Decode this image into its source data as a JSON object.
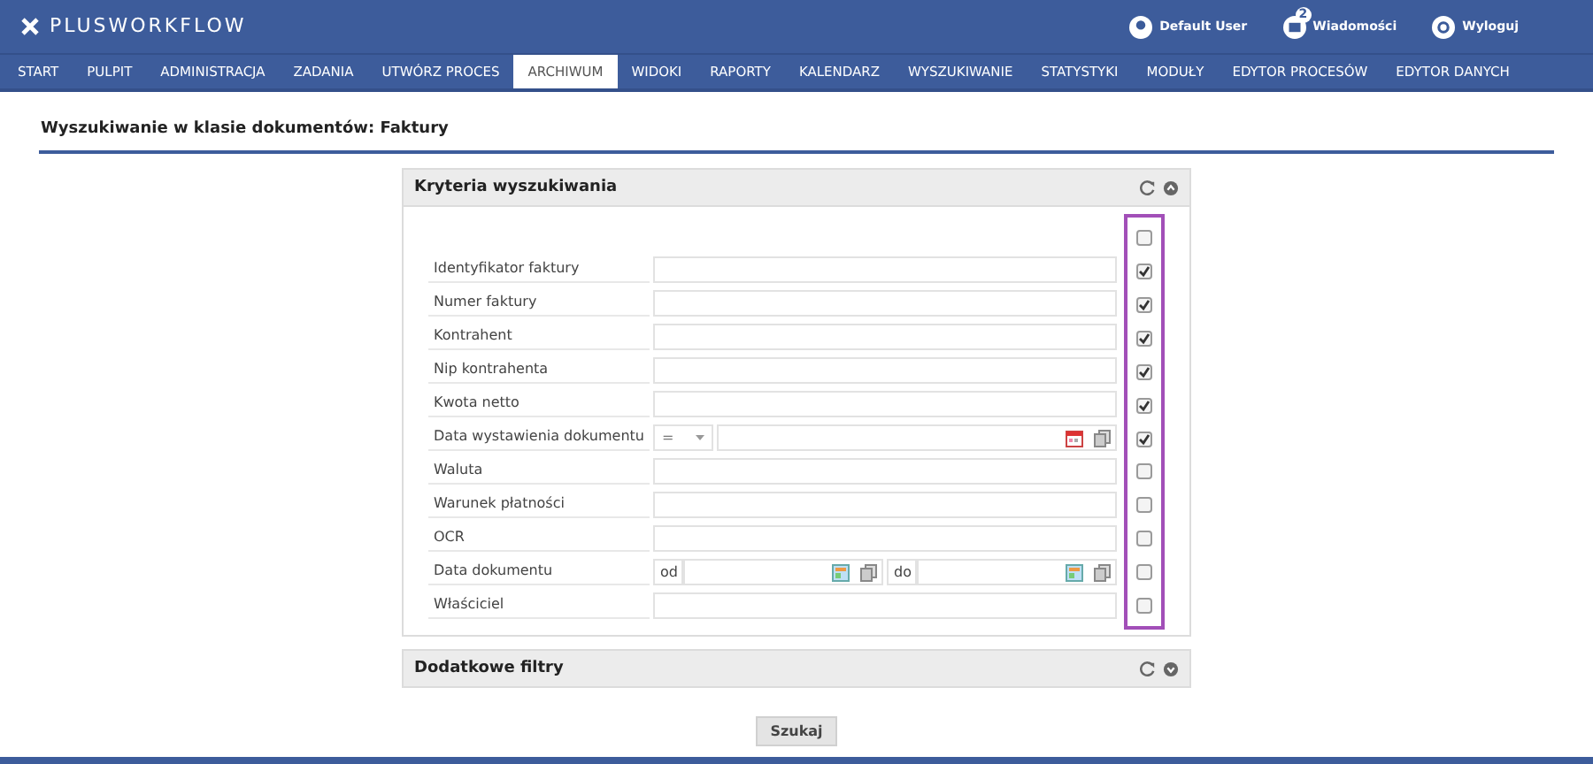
{
  "app": {
    "logo": "PLUSWORKFLOW"
  },
  "user_menu": [
    {
      "kind": "user",
      "label": "Default User"
    },
    {
      "kind": "messages",
      "label": "Wiadomości",
      "badge": "2"
    },
    {
      "kind": "logout",
      "label": "Wyloguj"
    }
  ],
  "nav": [
    {
      "label": "START",
      "selected": false
    },
    {
      "label": "PULPIT",
      "selected": false
    },
    {
      "label": "ADMINISTRACJA",
      "selected": false
    },
    {
      "label": "ZADANIA",
      "selected": false
    },
    {
      "label": "UTWÓRZ PROCES",
      "selected": false
    },
    {
      "label": "ARCHIWUM",
      "selected": true
    },
    {
      "label": "WIDOKI",
      "selected": false
    },
    {
      "label": "RAPORTY",
      "selected": false
    },
    {
      "label": "KALENDARZ",
      "selected": false
    },
    {
      "label": "WYSZUKIWANIE",
      "selected": false
    },
    {
      "label": "STATYSTYKI",
      "selected": false
    },
    {
      "label": "MODUŁY",
      "selected": false
    },
    {
      "label": "EDYTOR PROCESÓW",
      "selected": false
    },
    {
      "label": "EDYTOR DANYCH",
      "selected": false
    }
  ],
  "page_title": "Wyszukiwanie w klasie dokumentów: Faktury",
  "criteria": {
    "title": "Kryteria wyszukiwania",
    "select_all": {
      "checked": false
    },
    "fields": [
      {
        "kind": "text",
        "label": "Identyfikator faktury",
        "checked": true
      },
      {
        "kind": "text",
        "label": "Numer faktury",
        "checked": true
      },
      {
        "kind": "text",
        "label": "Kontrahent",
        "checked": true
      },
      {
        "kind": "text",
        "label": "Nip kontrahenta",
        "checked": true
      },
      {
        "kind": "text",
        "label": "Kwota netto",
        "checked": true
      },
      {
        "kind": "date_op",
        "label": "Data wystawienia dokumentu",
        "operator": "=",
        "checked": true
      },
      {
        "kind": "text",
        "label": "Waluta",
        "checked": false
      },
      {
        "kind": "text",
        "label": "Warunek płatności",
        "checked": false
      },
      {
        "kind": "text",
        "label": "OCR",
        "checked": false
      },
      {
        "kind": "date_range",
        "label": "Data dokumentu",
        "from_label": "od",
        "to_label": "do",
        "checked": false
      },
      {
        "kind": "text",
        "label": "Właściciel",
        "checked": false
      }
    ]
  },
  "extra_filters": {
    "title": "Dodatkowe filtry"
  },
  "search_button": "Szukaj"
}
